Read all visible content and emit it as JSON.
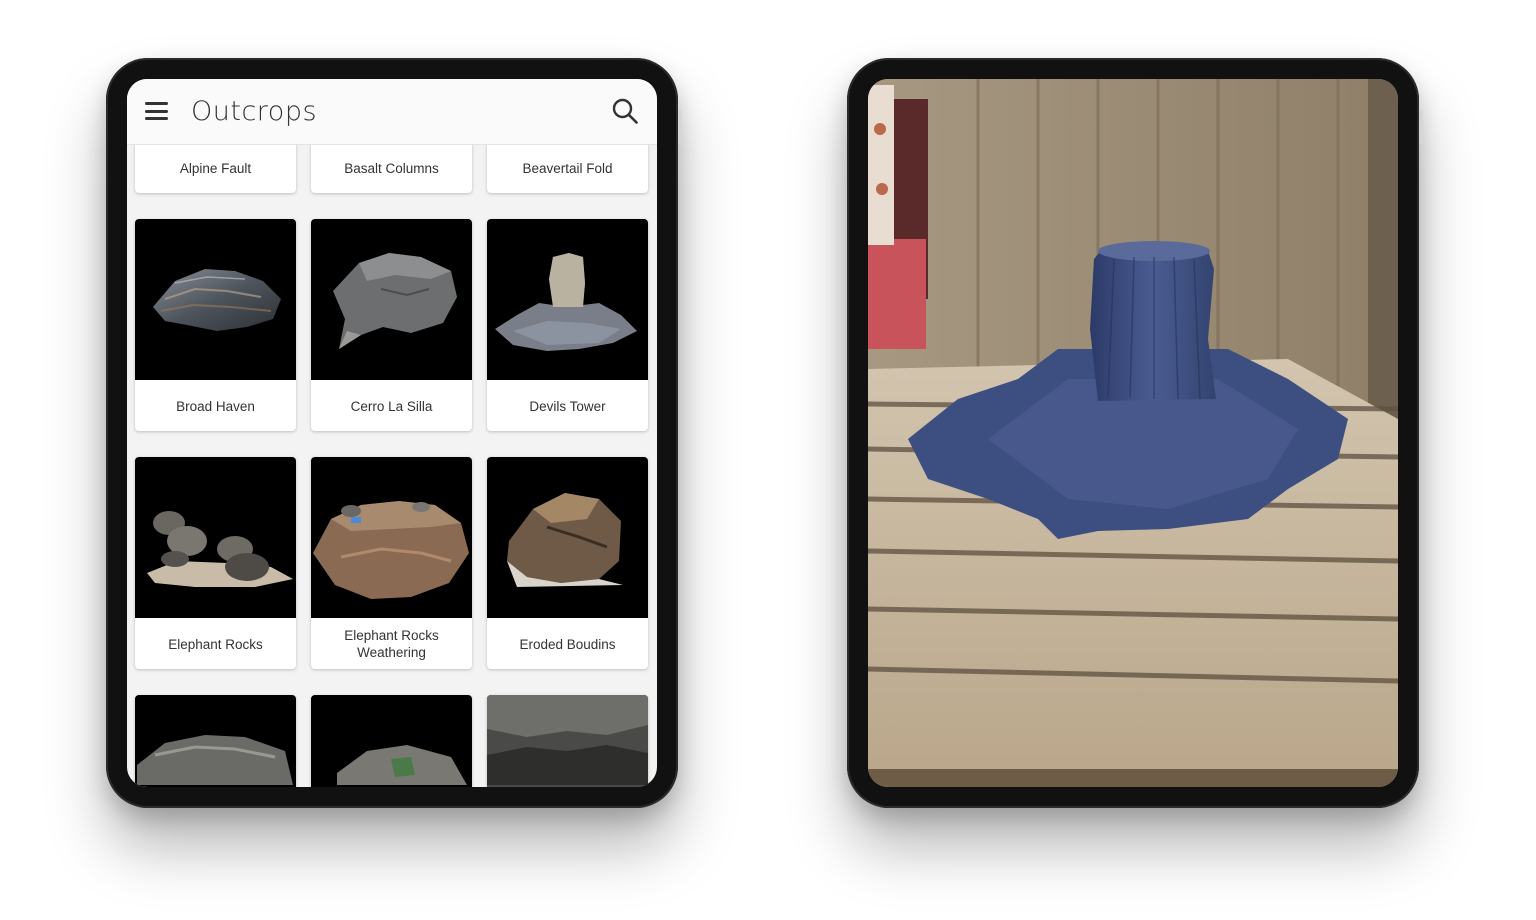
{
  "app": {
    "title": "Outcrops"
  },
  "icons": {
    "menu": "hamburger-menu-icon",
    "search": "search-icon"
  },
  "colors": {
    "screen_bg": "#f3f3f3",
    "appbar_bg": "#fafafa",
    "text": "#333333",
    "thumb_bg": "#000000",
    "ar_model": "#3d4e80"
  },
  "outcrops": [
    {
      "name": "Alpine Fault"
    },
    {
      "name": "Basalt Columns"
    },
    {
      "name": "Beavertail Fold"
    },
    {
      "name": "Broad Haven"
    },
    {
      "name": "Cerro La Silla"
    },
    {
      "name": "Devils Tower"
    },
    {
      "name": "Elephant Rocks"
    },
    {
      "name": "Elephant Rocks Weathering"
    },
    {
      "name": "Eroded Boudins"
    },
    {
      "name": ""
    },
    {
      "name": ""
    },
    {
      "name": ""
    }
  ]
}
